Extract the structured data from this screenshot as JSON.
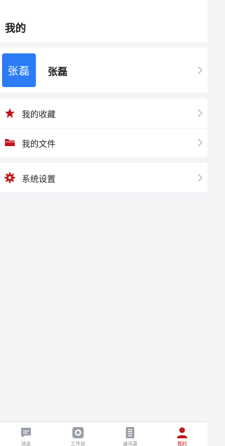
{
  "header": {
    "title": "我的"
  },
  "profile": {
    "avatar_text": "张磊",
    "name": "张磊"
  },
  "menu": [
    {
      "label": "我的收藏",
      "icon": "star-icon"
    },
    {
      "label": "我的文件",
      "icon": "folder-icon"
    },
    {
      "label": "系统设置",
      "icon": "gear-icon"
    }
  ],
  "tabs": [
    {
      "label": "消息",
      "icon": "message-icon"
    },
    {
      "label": "工作台",
      "icon": "workbench-icon"
    },
    {
      "label": "通讯录",
      "icon": "contacts-icon"
    },
    {
      "label": "我的",
      "icon": "user-icon",
      "active": true
    }
  ],
  "colors": {
    "accent": "#c0161b",
    "avatar": "#2b7cf6"
  }
}
